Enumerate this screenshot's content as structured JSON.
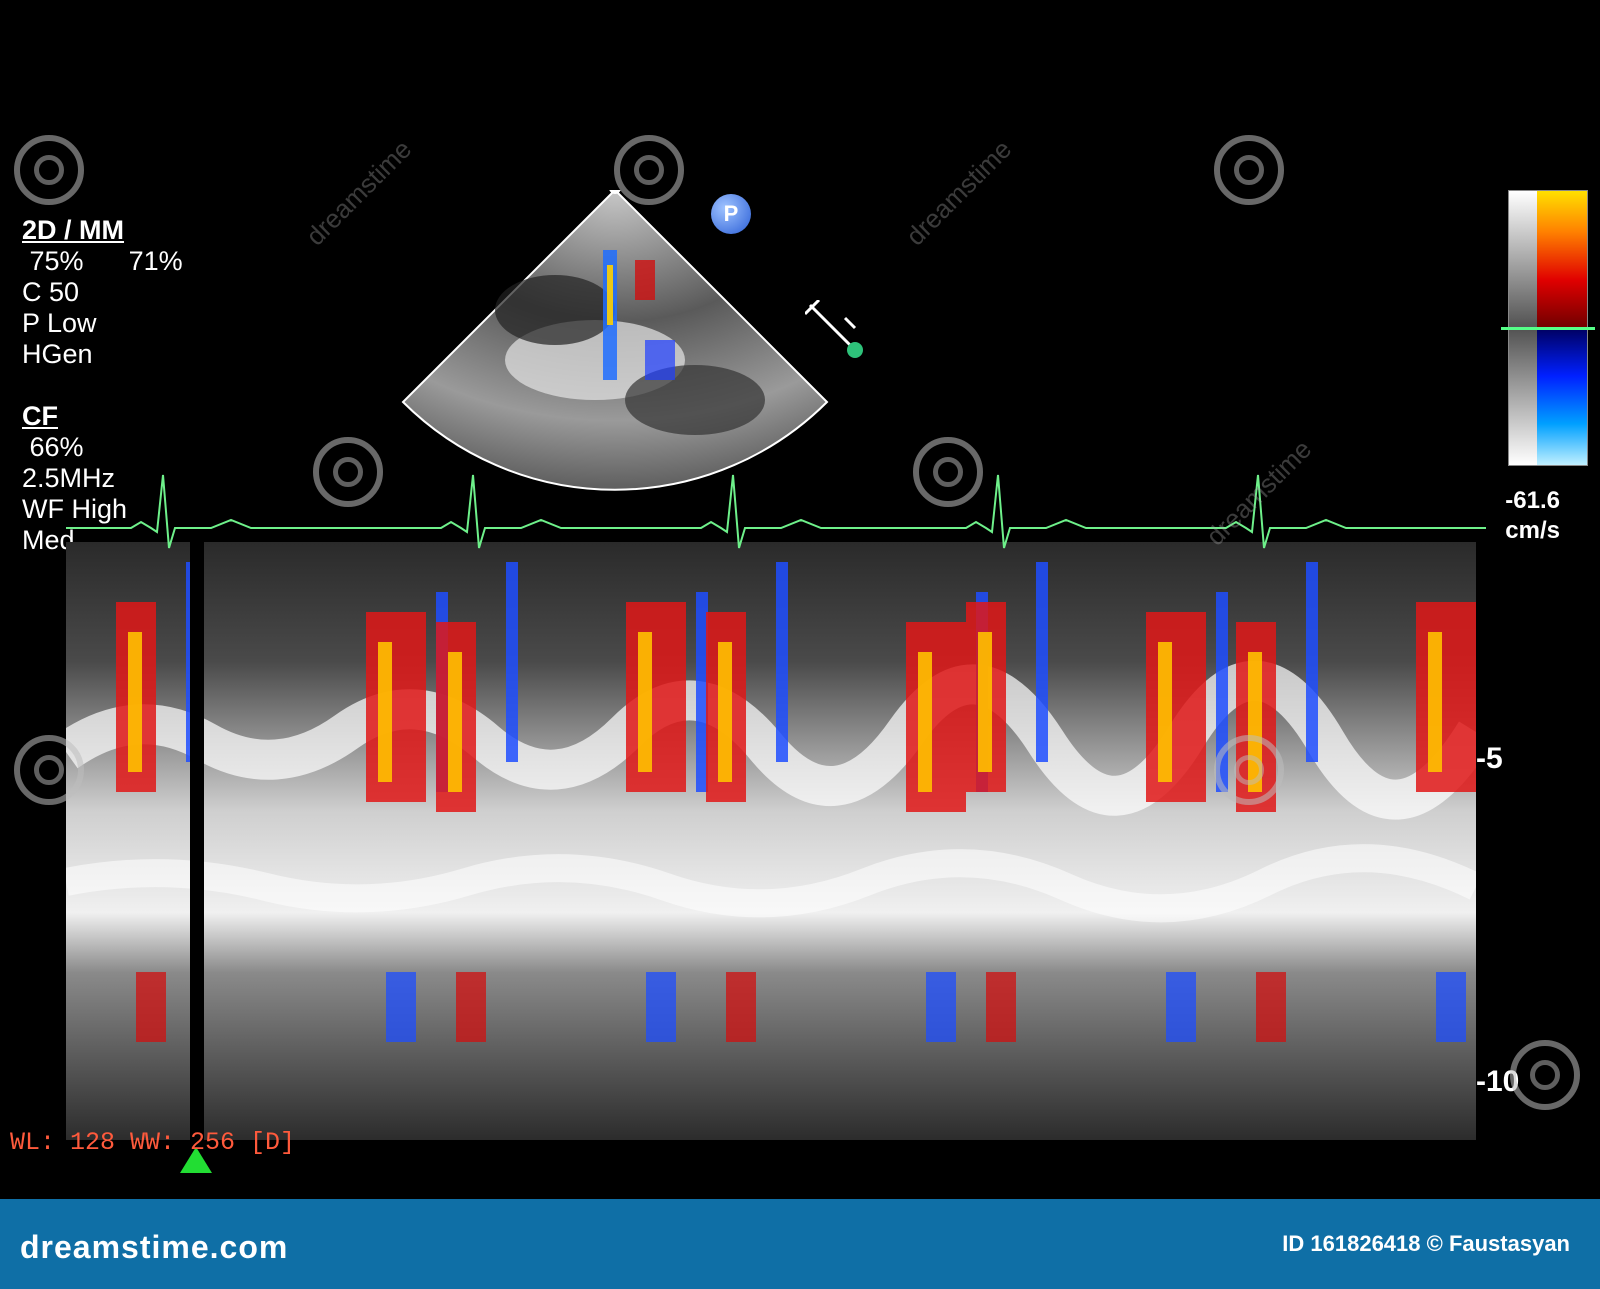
{
  "mode": {
    "header": "2D / MM",
    "gain_1": "75%",
    "gain_2": "71%",
    "compression": "C 50",
    "power": "P Low",
    "frequency_mode": "HGen"
  },
  "color_flow": {
    "header": "CF",
    "gain": "66%",
    "frequency": "2.5MHz",
    "wall_filter": "WF High",
    "setting": "Med"
  },
  "scale": {
    "value": "-61.6",
    "unit": "cm/s"
  },
  "probe_marker": "P",
  "window_level": "WL: 128 WW: 256 [D]",
  "depth_marks": [
    "-5",
    "-10"
  ],
  "footer": {
    "brand": "dreamstime.com",
    "credit": "ID 161826418 © Faustasyan"
  },
  "watermark_text": "dreamstime",
  "colors": {
    "ecg_trace": "#6ef08a",
    "footer_bar": "#0f6fa6",
    "wl_text": "#ff5a3c",
    "marker": "#22dd33"
  }
}
